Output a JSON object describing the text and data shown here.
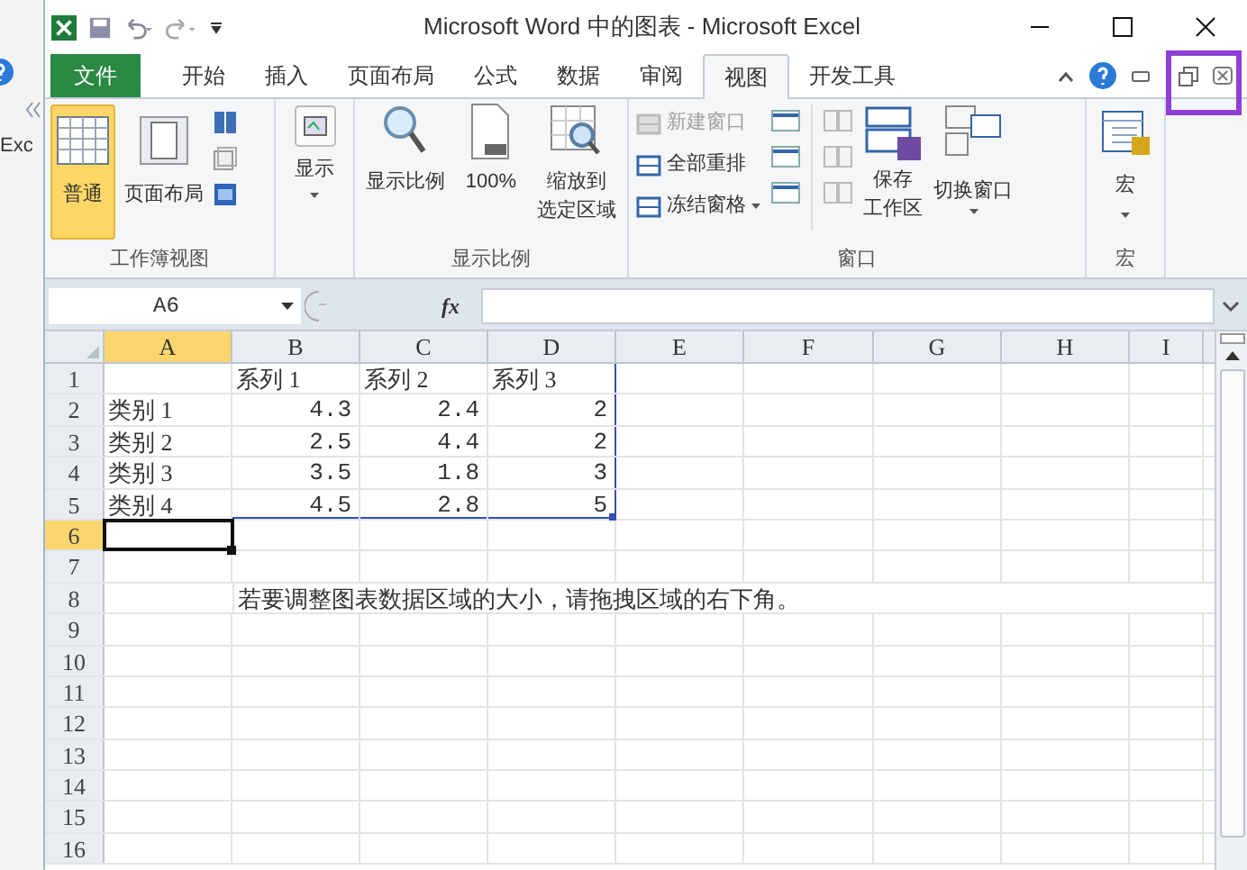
{
  "background_window": {
    "label": "Exc"
  },
  "window": {
    "title": "Microsoft Word 中的图表 - Microsoft Excel"
  },
  "tabs": [
    {
      "label": "文件",
      "kind": "file",
      "selected": false
    },
    {
      "label": "开始",
      "kind": "tab",
      "selected": false
    },
    {
      "label": "插入",
      "kind": "tab",
      "selected": false
    },
    {
      "label": "页面布局",
      "kind": "tab",
      "selected": false
    },
    {
      "label": "公式",
      "kind": "tab",
      "selected": false
    },
    {
      "label": "数据",
      "kind": "tab",
      "selected": false
    },
    {
      "label": "审阅",
      "kind": "tab",
      "selected": false
    },
    {
      "label": "视图",
      "kind": "tab",
      "selected": true
    },
    {
      "label": "开发工具",
      "kind": "tab",
      "selected": false
    }
  ],
  "ribbon": {
    "workbook_views": {
      "label": "工作簿视图",
      "buttons": [
        {
          "label": "普通",
          "selected": true
        },
        {
          "label": "页面布局",
          "selected": false
        }
      ]
    },
    "show": {
      "label": "显示"
    },
    "zoom": {
      "label": "显示比例",
      "buttons": [
        [
          "显示比例"
        ],
        [
          "100%"
        ],
        [
          "缩放到",
          "选定区域"
        ]
      ]
    },
    "window": {
      "label": "窗口",
      "items": [
        {
          "label": "新建窗口",
          "disabled": true
        },
        {
          "label": "全部重排",
          "disabled": false
        },
        {
          "label": "冻结窗格",
          "disabled": false
        }
      ],
      "save": [
        "保存",
        "工作区"
      ],
      "switch": "切换窗口"
    },
    "macros": {
      "label": "宏",
      "button": "宏"
    }
  },
  "formula_bar": {
    "name_box": "A6",
    "function_label": "fx"
  },
  "sheet": {
    "columns": [
      {
        "label": "A",
        "selected": true
      },
      {
        "label": "B",
        "selected": false
      },
      {
        "label": "C",
        "selected": false
      },
      {
        "label": "D",
        "selected": false
      },
      {
        "label": "E",
        "selected": false
      },
      {
        "label": "F",
        "selected": false
      },
      {
        "label": "G",
        "selected": false
      },
      {
        "label": "H",
        "selected": false
      },
      {
        "label": "I",
        "selected": false
      }
    ],
    "rows": [
      {
        "header": "1",
        "selected": false,
        "cells": [
          null,
          {
            "text": "系列 1",
            "kind": "text"
          },
          {
            "text": "系列 2",
            "kind": "text"
          },
          {
            "text": "系列 3",
            "kind": "text"
          }
        ]
      },
      {
        "header": "2",
        "selected": false,
        "cells": [
          {
            "text": "类别 1",
            "kind": "text"
          },
          {
            "text": "4.3",
            "kind": "number"
          },
          {
            "text": "2.4",
            "kind": "number"
          },
          {
            "text": "2",
            "kind": "number"
          }
        ]
      },
      {
        "header": "3",
        "selected": false,
        "cells": [
          {
            "text": "类别 2",
            "kind": "text"
          },
          {
            "text": "2.5",
            "kind": "number"
          },
          {
            "text": "4.4",
            "kind": "number"
          },
          {
            "text": "2",
            "kind": "number"
          }
        ]
      },
      {
        "header": "4",
        "selected": false,
        "cells": [
          {
            "text": "类别 3",
            "kind": "text"
          },
          {
            "text": "3.5",
            "kind": "number"
          },
          {
            "text": "1.8",
            "kind": "number"
          },
          {
            "text": "3",
            "kind": "number"
          }
        ]
      },
      {
        "header": "5",
        "selected": false,
        "cells": [
          {
            "text": "类别 4",
            "kind": "text"
          },
          {
            "text": "4.5",
            "kind": "number"
          },
          {
            "text": "2.8",
            "kind": "number"
          },
          {
            "text": "5",
            "kind": "number"
          }
        ]
      },
      {
        "header": "6",
        "selected": true,
        "cells": []
      },
      {
        "header": "7",
        "selected": false,
        "cells": []
      },
      {
        "header": "8",
        "selected": false,
        "cells": [
          null,
          {
            "text": "若要调整图表数据区域的大小，请拖拽区域的右下角。",
            "kind": "text"
          }
        ]
      },
      {
        "header": "9",
        "selected": false,
        "cells": []
      },
      {
        "header": "10",
        "selected": false,
        "cells": []
      },
      {
        "header": "11",
        "selected": false,
        "cells": []
      },
      {
        "header": "12",
        "selected": false,
        "cells": []
      },
      {
        "header": "13",
        "selected": false,
        "cells": []
      },
      {
        "header": "14",
        "selected": false,
        "cells": []
      },
      {
        "header": "15",
        "selected": false,
        "cells": []
      },
      {
        "header": "16",
        "selected": false,
        "cells": []
      }
    ]
  }
}
